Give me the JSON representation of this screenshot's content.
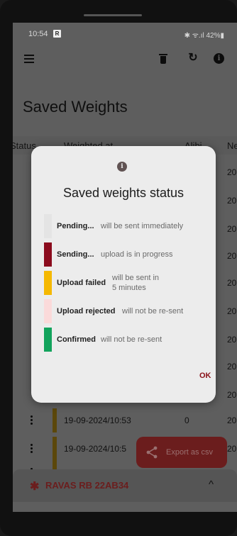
{
  "status_bar": {
    "time": "10:54",
    "icon_letter": "R",
    "right": "✱ ᯤ.ıl 42%▮"
  },
  "app_bar": {
    "refresh_glyph": "↻",
    "info_glyph": "i"
  },
  "page_title": "Saved Weights",
  "table": {
    "headers": [
      "Status",
      "Weighted at",
      "Alibi",
      "Ne"
    ],
    "visible_no_col": [
      "20",
      "20",
      "20",
      "20",
      "20",
      "20",
      "20",
      "20",
      "20",
      "20"
    ],
    "rows": [
      {
        "date": "19-09-2024/10:53",
        "alibi": "0",
        "no": "20"
      },
      {
        "date": "19-09-2024/10:5",
        "alibi": "",
        "no": "20"
      }
    ]
  },
  "fab": {
    "label": "Export as csv",
    "icon": "share-icon"
  },
  "bottom_bar": {
    "bluetooth_glyph": "✱",
    "device": "RAVAS RB 22AB34",
    "chevron": "^"
  },
  "dialog": {
    "info_glyph": "i",
    "title": "Saved weights status",
    "items": [
      {
        "name": "Pending...",
        "desc": "will be sent immediately",
        "color": "#e4e4e4"
      },
      {
        "name": "Sending...",
        "desc": "upload is in progress",
        "color": "#8b0b1d"
      },
      {
        "name": "Upload failed",
        "desc": "will be sent in 5 minutes",
        "color": "#f5b800"
      },
      {
        "name": "Upload rejected",
        "desc": "will not be re-sent",
        "color": "#fbdada"
      },
      {
        "name": "Confirmed",
        "desc": "will not be re-sent",
        "color": "#12a35c"
      }
    ],
    "ok_label": "OK"
  }
}
